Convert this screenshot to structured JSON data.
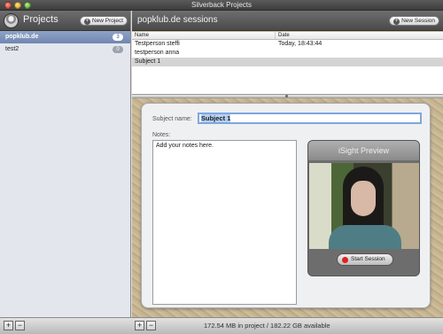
{
  "window": {
    "title": "Silverback Projects"
  },
  "sidebar": {
    "title": "Projects",
    "new_project_label": "New Project",
    "projects": [
      {
        "name": "popklub.de",
        "count": "3"
      },
      {
        "name": "test2",
        "count": "0"
      }
    ]
  },
  "main": {
    "title": "popklub.de sessions",
    "new_session_label": "New Session",
    "columns": {
      "name": "Name",
      "date": "Date"
    },
    "sessions": [
      {
        "name": "Testperson steffi",
        "date": "Today, 18:43:44"
      },
      {
        "name": "testperson anna",
        "date": ""
      },
      {
        "name": "Subject 1",
        "date": ""
      }
    ],
    "detail": {
      "subject_label": "Subject name:",
      "subject_value": "Subject 1",
      "notes_label": "Notes:",
      "notes_value": "Add your notes here.",
      "preview_title": "iSight Preview",
      "start_label": "Start Session"
    }
  },
  "footer": {
    "status": "172.54 MB in project / 182.22 GB available"
  },
  "colors": {
    "selection": "#6f86b2",
    "accent_focus": "#7fa6df",
    "record": "#e02020"
  }
}
